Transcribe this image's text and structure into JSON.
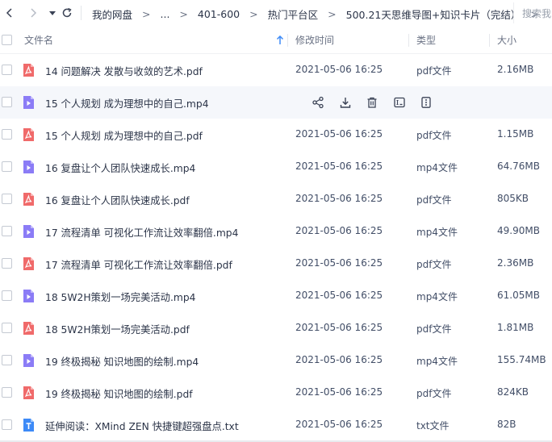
{
  "nav": {
    "back_icon": "chevron-left-icon",
    "forward_icon": "chevron-right-icon",
    "menu_icon": "caret-down-icon",
    "refresh_icon": "refresh-icon"
  },
  "breadcrumb": {
    "items": [
      "我的网盘",
      "...",
      "401-600",
      "热门平台区",
      "500.21天思维导图+知识卡片（完结）"
    ],
    "separator": ">"
  },
  "search": {
    "placeholder": "搜索我"
  },
  "columns": {
    "name": "文件名",
    "modified": "修改时间",
    "type": "类型",
    "size": "大小",
    "sort_icon": "arrow-up-icon"
  },
  "colors": {
    "pdf": "#f06a6a",
    "video": "#8b7cf6",
    "text": "#3d8af7",
    "accent": "#3d8af7"
  },
  "row_actions": [
    "share-icon",
    "download-icon",
    "delete-icon",
    "rename-icon",
    "more-icon"
  ],
  "files": [
    {
      "name": "14 问题解决 发散与收敛的艺术.pdf",
      "date": "2021-05-06 16:25",
      "type": "pdf文件",
      "size": "2.16MB",
      "kind": "pdf"
    },
    {
      "name": "15 个人规划 成为理想中的自己.mp4",
      "date": "",
      "type": "",
      "size": "",
      "kind": "video",
      "hover": true
    },
    {
      "name": "15 个人规划 成为理想中的自己.pdf",
      "date": "2021-05-06 16:25",
      "type": "pdf文件",
      "size": "1.15MB",
      "kind": "pdf"
    },
    {
      "name": "16 复盘让个人团队快速成长.mp4",
      "date": "2021-05-06 16:25",
      "type": "mp4文件",
      "size": "64.76MB",
      "kind": "video"
    },
    {
      "name": "16 复盘让个人团队快速成长.pdf",
      "date": "2021-05-06 16:25",
      "type": "pdf文件",
      "size": "805KB",
      "kind": "pdf"
    },
    {
      "name": "17 流程清单 可视化工作流让效率翻倍.mp4",
      "date": "2021-05-06 16:25",
      "type": "mp4文件",
      "size": "49.90MB",
      "kind": "video"
    },
    {
      "name": "17 流程清单 可视化工作流让效率翻倍.pdf",
      "date": "2021-05-06 16:25",
      "type": "pdf文件",
      "size": "2.36MB",
      "kind": "pdf"
    },
    {
      "name": "18 5W2H策划一场完美活动.mp4",
      "date": "2021-05-06 16:25",
      "type": "mp4文件",
      "size": "61.05MB",
      "kind": "video"
    },
    {
      "name": "18 5W2H策划一场完美活动.pdf",
      "date": "2021-05-06 16:25",
      "type": "pdf文件",
      "size": "1.81MB",
      "kind": "pdf"
    },
    {
      "name": "19 终极揭秘 知识地图的绘制.mp4",
      "date": "2021-05-06 16:25",
      "type": "mp4文件",
      "size": "155.74MB",
      "kind": "video"
    },
    {
      "name": "19 终极揭秘 知识地图的绘制.pdf",
      "date": "2021-05-06 16:25",
      "type": "pdf文件",
      "size": "824KB",
      "kind": "pdf"
    },
    {
      "name": "延伸阅读：XMind ZEN 快捷键超强盘点.txt",
      "date": "2021-05-06 16:25",
      "type": "txt文件",
      "size": "82B",
      "kind": "text"
    }
  ]
}
